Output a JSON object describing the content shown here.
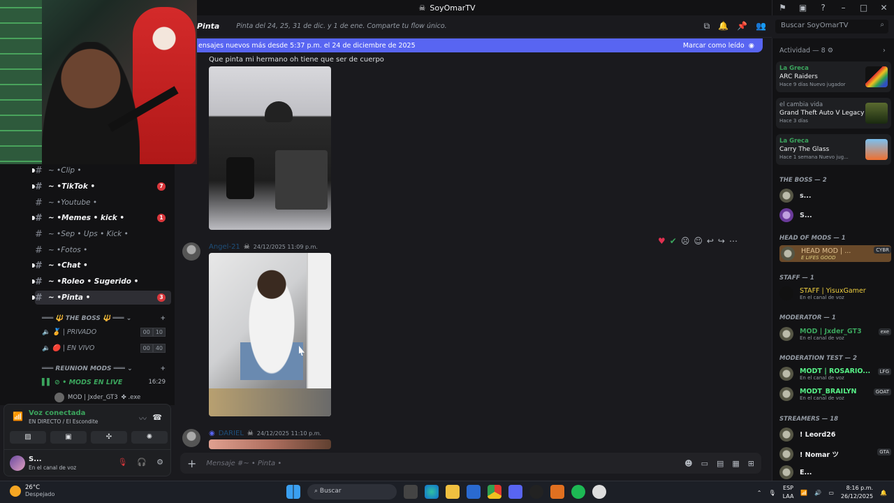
{
  "window": {
    "title": "SoyOmarTV"
  },
  "channel_header": {
    "name": "Pinta",
    "topic": "Pinta del 24, 25, 31 de dic. y 1 de ene. Comparte tu flow único.",
    "search_placeholder": "Buscar SoyOmarTV"
  },
  "new_messages_bar": {
    "text": "ensajes nuevos más desde 5:37 p.m. el 24 de diciembre de 2025",
    "mark_read": "Marcar como leído"
  },
  "channels": [
    {
      "label": "Clip",
      "badge": ""
    },
    {
      "label": "TikTok",
      "badge": "7"
    },
    {
      "label": "Youtube",
      "badge": ""
    },
    {
      "label": "Memes • kick",
      "badge": "1"
    },
    {
      "label": "Sep • Ups • Kick",
      "badge": ""
    },
    {
      "label": "Fotos",
      "badge": ""
    },
    {
      "label": "Chat",
      "badge": ""
    },
    {
      "label": "Roleo • Sugerido",
      "badge": ""
    },
    {
      "label": "Pinta",
      "badge": "3"
    }
  ],
  "categories": {
    "boss": "THE BOSS",
    "reunion": "REUNION MODS"
  },
  "voice_channels": {
    "privado": {
      "label": "| PRIVADO",
      "a": "00",
      "b": "10"
    },
    "envivo": {
      "label": "| EN VIVO",
      "a": "00",
      "b": "40"
    },
    "live": {
      "label": "• MODS EN LIVE",
      "time": "16:29"
    },
    "user": "MOD | Jxder_GT3",
    "user_tag": "exe"
  },
  "voice_panel": {
    "status": "Voz conectada",
    "sub": "EN DIRECTO / El Escondite"
  },
  "user_panel": {
    "name": "S...",
    "status": "En el canal de voz"
  },
  "messages": {
    "text1": "Que pinta mi hermano oh tiene que ser de cuerpo",
    "author2": "Angel-21",
    "ts2": "24/12/2025 11:09 p.m.",
    "author3": "DARIEL",
    "ts3": "24/12/2025 11:10 p.m."
  },
  "composer": {
    "placeholder": "Mensaje #~ • Pinta •"
  },
  "activity": {
    "title": "Actividad — 8",
    "cards": [
      {
        "who": "La Greca",
        "game": "ARC Raiders",
        "meta": "Hace 9 días  Nuevo jugador"
      },
      {
        "who": "el cambia vida",
        "game": "Grand Theft Auto V Legacy",
        "meta": "Hace 3 días"
      },
      {
        "who": "La Greca",
        "game": "Carry The Glass",
        "meta": "Hace 1 semana  Nuevo jug..."
      }
    ]
  },
  "members": {
    "boss_title": "THE BOSS — 2",
    "boss1": "s...",
    "boss2": "S...",
    "head_title": "HEAD OF MODS — 1",
    "head1": "HEAD MOD | ...",
    "head1_sub": "E LIFES GOOD",
    "head1_tag": "CYBR",
    "staff_title": "STAFF — 1",
    "staff1": "STAFF | YisuxGamer",
    "staff1_sub": "En el canal de voz",
    "mod_title": "MODERATOR — 1",
    "mod1": "MOD | Jxder_GT3",
    "mod1_sub": "En el canal de voz",
    "mod1_tag": "exe",
    "test_title": "MODERATION TEST — 2",
    "test1": "MODT | ROSARIO...",
    "test1_sub": "En el canal de voz",
    "test1_tag": "LFG",
    "test2": "MODT_BRAILYN",
    "test2_sub": "En el canal de voz",
    "test2_tag": "GOAT",
    "streamers_title": "STREAMERS — 18",
    "str1": "! Leord26",
    "str2": "! Nomar ツ",
    "str2_tag": "GTA",
    "str3": "E..."
  },
  "taskbar": {
    "temp": "26°C",
    "weather": "Despejado",
    "search": "Buscar",
    "lang1": "ESP",
    "lang2": "LAA",
    "time": "8:16 p.m.",
    "date": "26/12/2025"
  },
  "colors": {
    "accent": "#5865f2",
    "online": "#3ba55d",
    "badge": "#da373c"
  }
}
